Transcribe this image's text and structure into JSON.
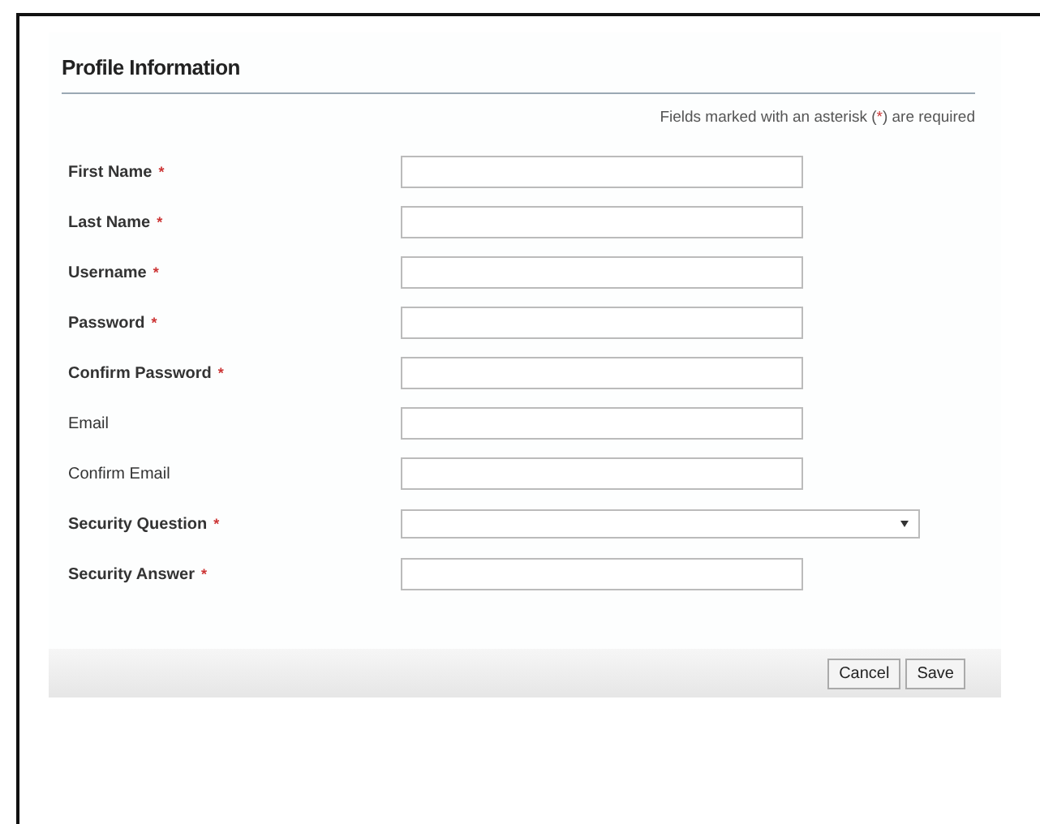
{
  "title": "Profile Information",
  "note": {
    "before": "Fields marked with an asterisk (",
    "mark": "*",
    "after": ") are required"
  },
  "fields": [
    {
      "label": "First Name",
      "required": true,
      "kind": "text"
    },
    {
      "label": "Last Name",
      "required": true,
      "kind": "text"
    },
    {
      "label": "Username",
      "required": true,
      "kind": "text"
    },
    {
      "label": "Password",
      "required": true,
      "kind": "text"
    },
    {
      "label": "Confirm Password",
      "required": true,
      "kind": "text"
    },
    {
      "label": "Email",
      "required": false,
      "kind": "text"
    },
    {
      "label": "Confirm Email",
      "required": false,
      "kind": "text"
    },
    {
      "label": "Security Question",
      "required": true,
      "kind": "select"
    },
    {
      "label": "Security Answer",
      "required": true,
      "kind": "text"
    }
  ],
  "required_mark": "*",
  "buttons": [
    "Cancel",
    "Save"
  ]
}
